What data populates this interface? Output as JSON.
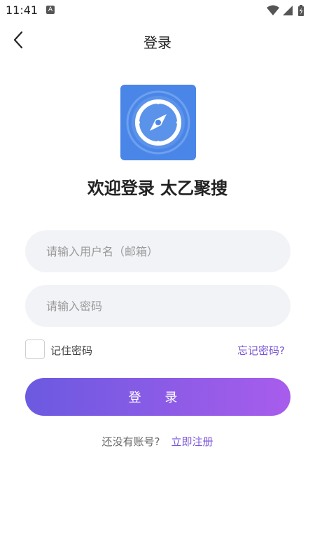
{
  "status_bar": {
    "time": "11:41",
    "notification_icon_letter": "A",
    "icons": [
      "wifi-icon",
      "signal-icon",
      "battery-icon"
    ]
  },
  "navbar": {
    "title": "登录",
    "back_icon": "chevron-left-icon"
  },
  "logo": {
    "icon": "compass-icon",
    "color": "#4a86e8"
  },
  "welcome_title": "欢迎登录 太乙聚搜",
  "form": {
    "username_placeholder": "请输入用户名（邮箱）",
    "username_value": "",
    "password_placeholder": "请输入密码",
    "password_value": "",
    "remember_label": "记住密码",
    "remember_checked": false,
    "forgot_label": "忘记密码?",
    "login_label": "登 录"
  },
  "register": {
    "prompt": "还没有账号?",
    "link_label": "立即注册"
  },
  "colors": {
    "accent": "#7a55d8",
    "button_gradient_start": "#6b5ae0",
    "button_gradient_end": "#a85cec",
    "field_bg": "#f2f3f7"
  }
}
